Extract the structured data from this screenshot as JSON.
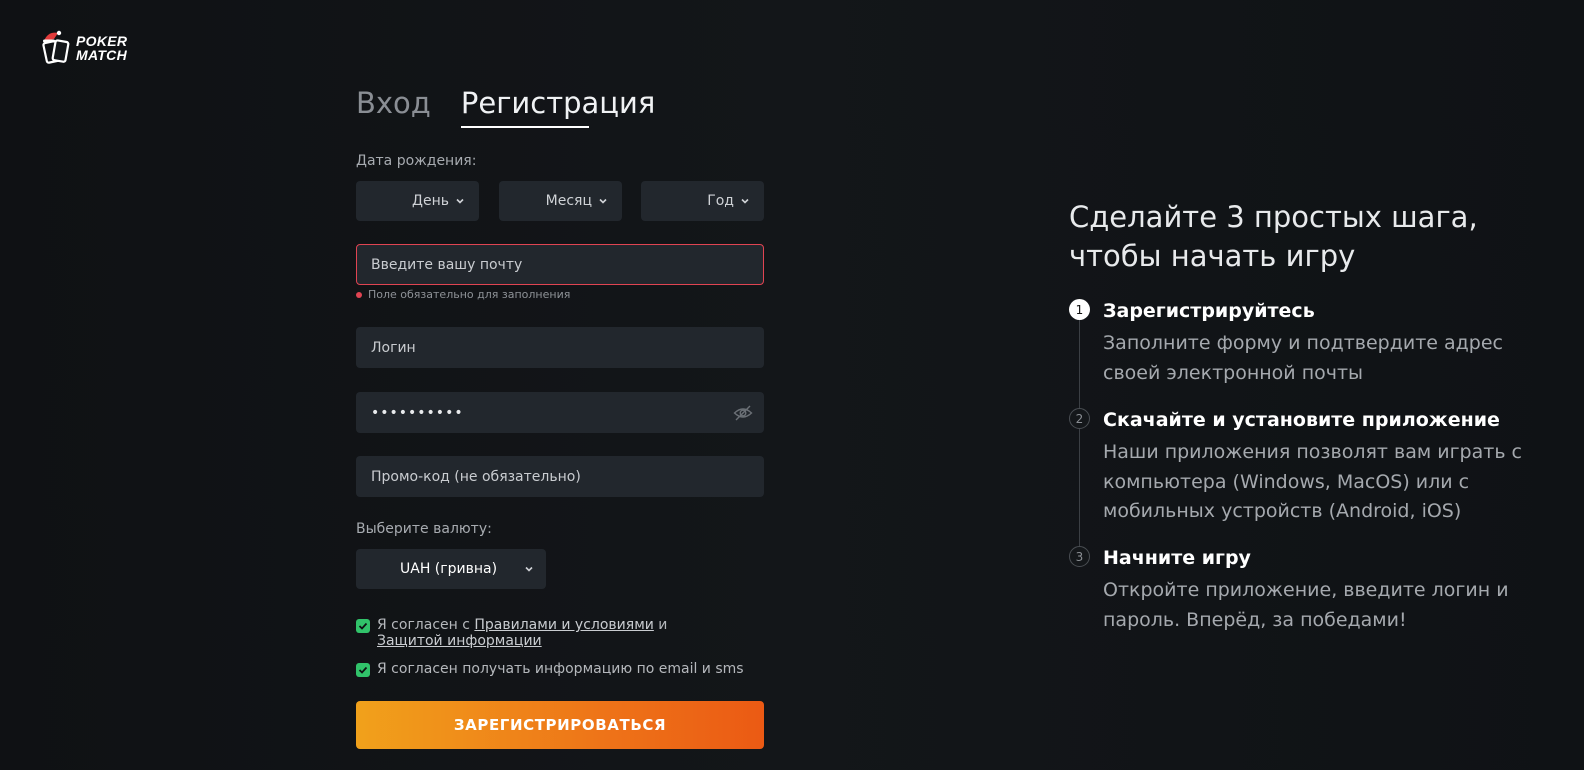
{
  "brand": {
    "logo_line1": "POKER",
    "logo_line2": "MATCH"
  },
  "tabs": {
    "login": "Вход",
    "register": "Регистрация"
  },
  "form": {
    "birth_label": "Дата рождения:",
    "day": "День",
    "month": "Месяц",
    "year": "Год",
    "email_placeholder": "Введите вашу почту",
    "email_error": "Поле обязательно для заполнения",
    "login_placeholder": "Логин",
    "password_value": "••••••••••",
    "promo_placeholder": "Промо-код (не обязательно)",
    "currency_label": "Выберите валюту:",
    "currency_value": "UAH (гривна)",
    "agree_prefix": "Я согласен с ",
    "agree_rules_link": "Правилами и условиями",
    "agree_and": " и",
    "agree_privacy_link": "Защитой информации",
    "agree_marketing": "Я согласен получать информацию по email и sms",
    "submit": "ЗАРЕГИСТРИРОВАТЬСЯ"
  },
  "steps": {
    "title": "Сделайте 3 простых шага, чтобы начать игру",
    "items": [
      {
        "num": "1",
        "title": "Зарегистрируйтесь",
        "desc": "Заполните форму и подтвердите адрес своей электронной почты"
      },
      {
        "num": "2",
        "title": "Скачайте и установите приложение",
        "desc": "Наши приложения позволят вам играть с компьютера (Windows, MacOS) или с мобильных устройств (Android, iOS)"
      },
      {
        "num": "3",
        "title": "Начните игру",
        "desc": "Откройте приложение, введите логин и пароль. Вперёд, за победами!"
      }
    ]
  },
  "colors": {
    "accent_start": "#f1a11b",
    "accent_end": "#eb5a14",
    "error": "#e04452",
    "checkbox": "#31c36a",
    "field_bg": "#22272d"
  },
  "icons": {
    "logo": "pokermatch-logo",
    "chevron": "chevron-down-icon",
    "eye": "eye-off-icon",
    "check": "check-icon"
  }
}
